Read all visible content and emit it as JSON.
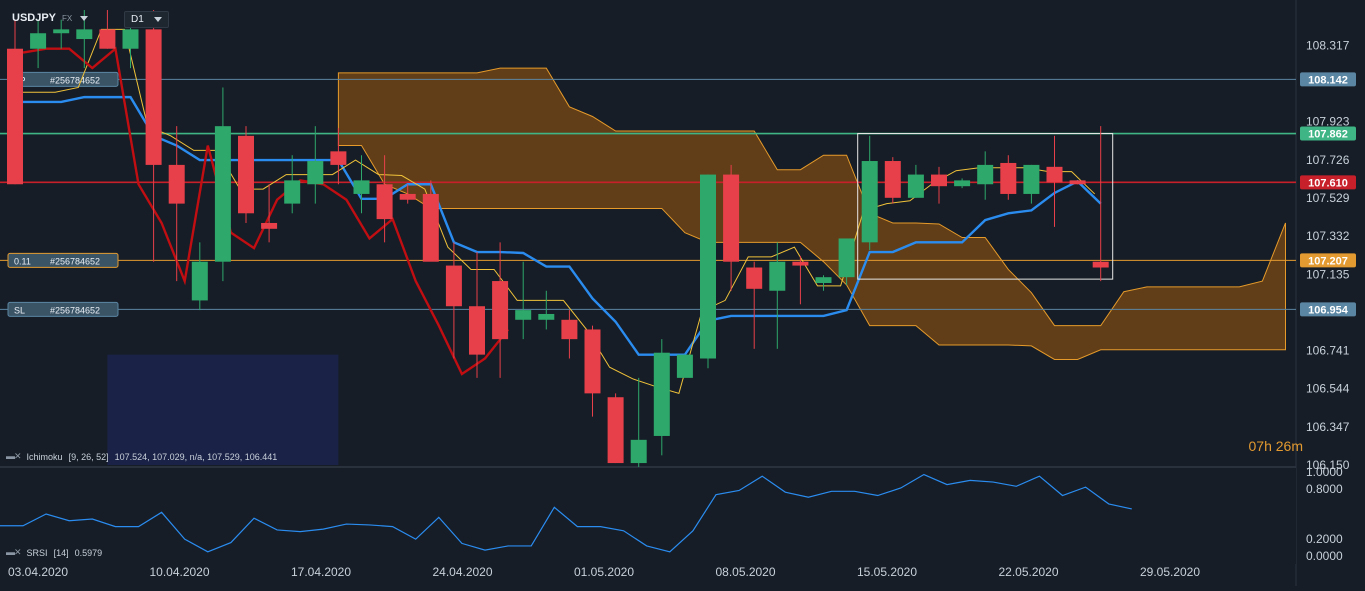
{
  "header": {
    "symbol": "USDJPY",
    "market": "FX",
    "timeframe": "D1"
  },
  "timer": "07h 26m",
  "colors": {
    "bull": "#2ea86b",
    "bear": "#e8404a",
    "cloud": "#7b4a14",
    "cloud_down": "#1b2450",
    "tenkan": "#2b8cf0",
    "kijun": "#c00e12",
    "level": "#3b9a8a"
  },
  "chart_data": [
    {
      "type": "candlestick",
      "ylim": [
        106.15,
        108.5
      ],
      "yticks": [
        "108.317",
        "107.923",
        "107.726",
        "107.529",
        "107.332",
        "107.135",
        "106.741",
        "106.544",
        "106.347",
        "106.150"
      ],
      "xticks": [
        "03.04.2020",
        "10.04.2020",
        "17.04.2020",
        "24.04.2020",
        "01.05.2020",
        "08.05.2020",
        "15.05.2020",
        "22.05.2020",
        "29.05.2020"
      ],
      "candles": [
        [
          108.3,
          108.45,
          107.6,
          107.6
        ],
        [
          108.3,
          108.45,
          108.2,
          108.38
        ],
        [
          108.38,
          108.45,
          108.3,
          108.4
        ],
        [
          108.35,
          108.5,
          108.2,
          108.4
        ],
        [
          108.4,
          108.5,
          108.3,
          108.3
        ],
        [
          108.3,
          108.45,
          108.2,
          108.4
        ],
        [
          108.4,
          108.5,
          107.2,
          107.7
        ],
        [
          107.7,
          107.9,
          107.1,
          107.5
        ],
        [
          107.0,
          107.3,
          106.95,
          107.2
        ],
        [
          107.2,
          108.1,
          107.1,
          107.9
        ],
        [
          107.85,
          107.9,
          107.4,
          107.45
        ],
        [
          107.4,
          107.6,
          107.3,
          107.37
        ],
        [
          107.5,
          107.75,
          107.45,
          107.62
        ],
        [
          107.6,
          107.9,
          107.5,
          107.72
        ],
        [
          107.77,
          107.89,
          107.6,
          107.7
        ],
        [
          107.55,
          107.75,
          107.45,
          107.62
        ],
        [
          107.6,
          107.75,
          107.3,
          107.42
        ],
        [
          107.55,
          107.6,
          107.5,
          107.52
        ],
        [
          107.55,
          107.62,
          107.4,
          107.2
        ],
        [
          107.18,
          107.3,
          106.7,
          106.97
        ],
        [
          106.97,
          107.25,
          106.6,
          106.72
        ],
        [
          107.1,
          107.3,
          106.6,
          106.8
        ],
        [
          106.9,
          107.2,
          106.8,
          106.95
        ],
        [
          106.9,
          107.05,
          106.85,
          106.93
        ],
        [
          106.9,
          106.95,
          106.7,
          106.8
        ],
        [
          106.85,
          106.87,
          106.4,
          106.52
        ],
        [
          106.5,
          106.52,
          106.16,
          106.16
        ],
        [
          106.16,
          106.6,
          106.14,
          106.28
        ],
        [
          106.3,
          106.8,
          106.2,
          106.73
        ],
        [
          106.6,
          106.72,
          106.65,
          106.72
        ],
        [
          106.7,
          107.65,
          106.65,
          107.65
        ],
        [
          107.65,
          107.7,
          107.05,
          107.2
        ],
        [
          107.17,
          107.2,
          106.75,
          107.06
        ],
        [
          107.05,
          107.3,
          106.75,
          107.2
        ],
        [
          107.2,
          107.23,
          106.98,
          107.18
        ],
        [
          107.09,
          107.13,
          107.05,
          107.12
        ],
        [
          107.12,
          107.3,
          107.08,
          107.32
        ],
        [
          107.3,
          107.85,
          107.26,
          107.72
        ],
        [
          107.72,
          107.74,
          107.5,
          107.53
        ],
        [
          107.53,
          107.7,
          107.53,
          107.65
        ],
        [
          107.65,
          107.69,
          107.5,
          107.59
        ],
        [
          107.59,
          107.63,
          107.58,
          107.62
        ],
        [
          107.6,
          107.77,
          107.52,
          107.7
        ],
        [
          107.71,
          107.75,
          107.52,
          107.55
        ],
        [
          107.55,
          107.7,
          107.5,
          107.7
        ],
        [
          107.69,
          107.85,
          107.38,
          107.61
        ],
        [
          107.62,
          107.62,
          107.6,
          107.6
        ],
        [
          107.2,
          107.9,
          107.1,
          107.17
        ]
      ],
      "horizontal_levels": [
        {
          "label": "TP",
          "ticket": "#256784652",
          "price": "108.142",
          "color": "#5b86a3"
        },
        {
          "label": "",
          "ticket": "",
          "price": "107.862",
          "color": "#3fb585"
        },
        {
          "label": "",
          "ticket": "",
          "price": "107.610",
          "color": "#c8202b"
        },
        {
          "label": "0.11",
          "ticket": "#256784652",
          "price": "107.207",
          "color": "#e39a30"
        },
        {
          "label": "SL",
          "ticket": "#256784652",
          "price": "106.954",
          "color": "#5b86a3"
        }
      ],
      "ichimoku": {
        "name": "Ichimoku",
        "params": "[9, 26, 52]",
        "values": "107.524,  107.029,  n/a,  107.529,  106.441"
      },
      "box": {
        "from_index": 37,
        "to_index": 47,
        "high": 107.862,
        "low": 107.11
      }
    },
    {
      "type": "line",
      "name": "SRSI",
      "params": "[14]",
      "value": "0.5979",
      "ylim": [
        0,
        1
      ],
      "yticks": [
        "1.0000",
        "0.8000",
        "0.2000",
        "0.0000"
      ],
      "values": [
        0.36,
        0.36,
        0.5,
        0.42,
        0.44,
        0.35,
        0.35,
        0.52,
        0.2,
        0.05,
        0.16,
        0.45,
        0.31,
        0.29,
        0.32,
        0.38,
        0.37,
        0.35,
        0.2,
        0.46,
        0.15,
        0.07,
        0.12,
        0.12,
        0.58,
        0.35,
        0.35,
        0.3,
        0.12,
        0.05,
        0.3,
        0.73,
        0.78,
        0.95,
        0.76,
        0.7,
        0.77,
        0.77,
        0.72,
        0.81,
        0.97,
        0.85,
        0.9,
        0.88,
        0.83,
        0.95,
        0.72,
        0.82,
        0.62,
        0.56
      ]
    }
  ]
}
